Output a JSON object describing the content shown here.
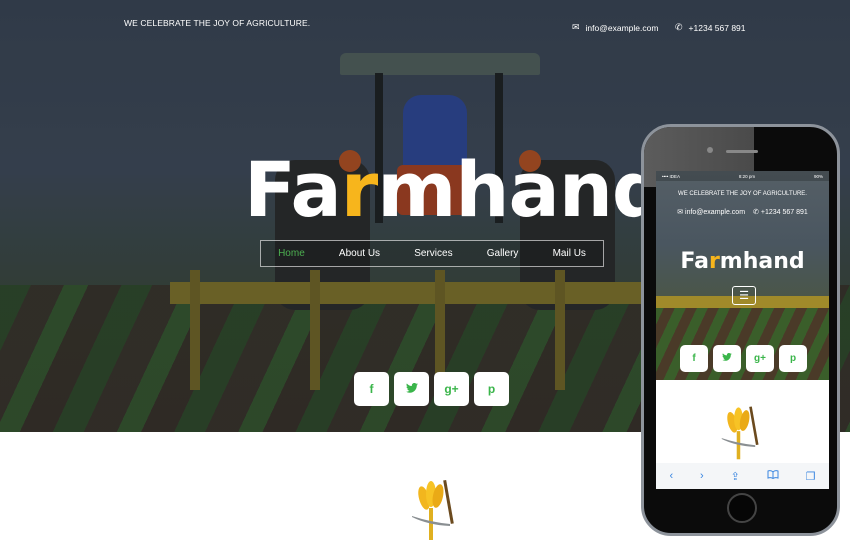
{
  "header": {
    "tagline": "WE CELEBRATE THE JOY OF AGRICULTURE.",
    "email": "info@example.com",
    "phone": "+1234 567 891",
    "email_icon": "envelope-icon",
    "phone_icon": "phone-icon"
  },
  "brand": {
    "prefix": "Fa",
    "accent": "r",
    "suffix": "mhand",
    "accent_color": "#f7b51c"
  },
  "nav": {
    "items": [
      {
        "label": "Home",
        "active": true
      },
      {
        "label": "About Us"
      },
      {
        "label": "Services"
      },
      {
        "label": "Gallery"
      },
      {
        "label": "Mail Us"
      }
    ],
    "active_color": "#4caf50"
  },
  "social": [
    {
      "name": "facebook",
      "glyph": "f"
    },
    {
      "name": "twitter",
      "glyph": "t"
    },
    {
      "name": "google-plus",
      "glyph": "g+"
    },
    {
      "name": "pinterest",
      "glyph": "p"
    }
  ],
  "social_color": "#3ab54a",
  "phone_mock": {
    "status": {
      "carrier": "•••• IDEA",
      "time": "8:20 pm",
      "battery": "90%"
    },
    "menu_glyph": "☰",
    "toolbar": {
      "back": "‹",
      "forward": "›",
      "share": "⇪",
      "bookmarks": "📖",
      "tabs": "❐"
    }
  }
}
